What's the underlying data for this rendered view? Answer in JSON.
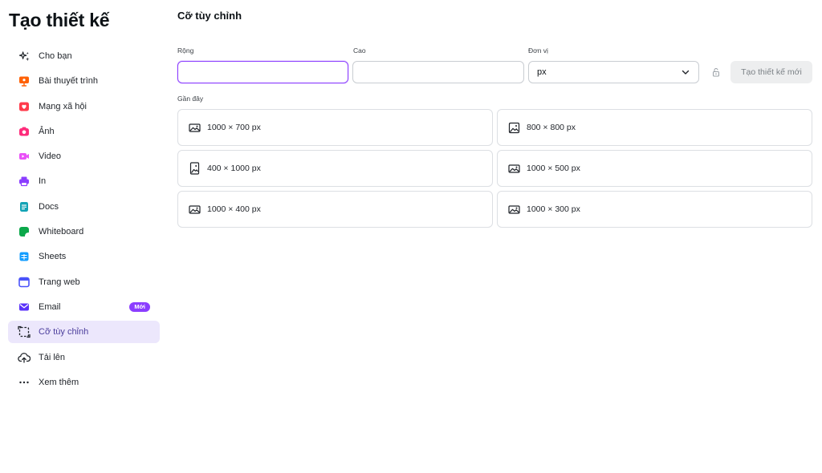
{
  "app": {
    "title": "Tạo thiết kế"
  },
  "sidebar": {
    "items": [
      {
        "label": "Cho bạn",
        "icon": "sparkles-icon",
        "color": "#1f2329"
      },
      {
        "label": "Bài thuyết trình",
        "icon": "presentation-icon",
        "color": "#ff6105"
      },
      {
        "label": "Mạng xã hội",
        "icon": "heart-icon",
        "color": "#ff3b4b"
      },
      {
        "label": "Ảnh",
        "icon": "camera-icon",
        "color": "#fe2c7b"
      },
      {
        "label": "Video",
        "icon": "video-icon",
        "color": "#e950f7"
      },
      {
        "label": "In",
        "icon": "printer-icon",
        "color": "#8b3dff"
      },
      {
        "label": "Docs",
        "icon": "docs-icon",
        "color": "#13a3b5"
      },
      {
        "label": "Whiteboard",
        "icon": "whiteboard-icon",
        "color": "#0ba84a"
      },
      {
        "label": "Sheets",
        "icon": "sheets-icon",
        "color": "#139dff"
      },
      {
        "label": "Trang web",
        "icon": "website-icon",
        "color": "#4a53fa"
      },
      {
        "label": "Email",
        "icon": "email-icon",
        "color": "#5a32fa",
        "badge": "Mới"
      },
      {
        "label": "Cỡ tùy chỉnh",
        "icon": "custom-size-icon",
        "color": "#1f2329",
        "active": true
      },
      {
        "label": "Tải lên",
        "icon": "upload-icon",
        "color": "#1f2329"
      },
      {
        "label": "Xem thêm",
        "icon": "more-icon",
        "color": "#1f2329"
      }
    ]
  },
  "main": {
    "title": "Cỡ tùy chỉnh",
    "width_label": "Rộng",
    "width_value": "",
    "height_label": "Cao",
    "height_value": "",
    "unit_label": "Đơn vị",
    "unit_value": "px",
    "create_label": "Tạo thiết kế mới",
    "recent_label": "Gần đây",
    "recent": [
      {
        "label": "1000 × 700 px",
        "icon": "landscape-image-icon"
      },
      {
        "label": "800 × 800 px",
        "icon": "square-image-icon"
      },
      {
        "label": "400 × 1000 px",
        "icon": "portrait-image-icon"
      },
      {
        "label": "1000 × 500 px",
        "icon": "landscape-image-icon"
      },
      {
        "label": "1000 × 400 px",
        "icon": "landscape-image-icon"
      },
      {
        "label": "1000 × 300 px",
        "icon": "landscape-image-icon"
      }
    ]
  },
  "colors": {
    "accent": "#8b3dff",
    "active_bg": "#ece7fc"
  }
}
